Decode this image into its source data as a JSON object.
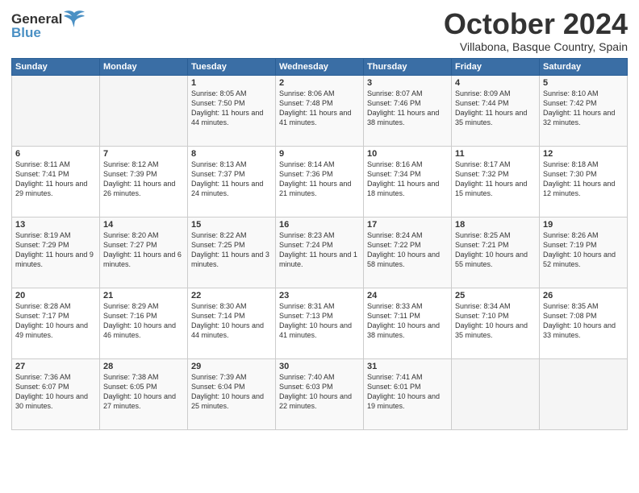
{
  "header": {
    "logo_line1": "General",
    "logo_line2": "Blue",
    "month": "October 2024",
    "location": "Villabona, Basque Country, Spain"
  },
  "weekdays": [
    "Sunday",
    "Monday",
    "Tuesday",
    "Wednesday",
    "Thursday",
    "Friday",
    "Saturday"
  ],
  "weeks": [
    [
      {
        "day": "",
        "content": ""
      },
      {
        "day": "",
        "content": ""
      },
      {
        "day": "1",
        "content": "Sunrise: 8:05 AM\nSunset: 7:50 PM\nDaylight: 11 hours\nand 44 minutes."
      },
      {
        "day": "2",
        "content": "Sunrise: 8:06 AM\nSunset: 7:48 PM\nDaylight: 11 hours\nand 41 minutes."
      },
      {
        "day": "3",
        "content": "Sunrise: 8:07 AM\nSunset: 7:46 PM\nDaylight: 11 hours\nand 38 minutes."
      },
      {
        "day": "4",
        "content": "Sunrise: 8:09 AM\nSunset: 7:44 PM\nDaylight: 11 hours\nand 35 minutes."
      },
      {
        "day": "5",
        "content": "Sunrise: 8:10 AM\nSunset: 7:42 PM\nDaylight: 11 hours\nand 32 minutes."
      }
    ],
    [
      {
        "day": "6",
        "content": "Sunrise: 8:11 AM\nSunset: 7:41 PM\nDaylight: 11 hours\nand 29 minutes."
      },
      {
        "day": "7",
        "content": "Sunrise: 8:12 AM\nSunset: 7:39 PM\nDaylight: 11 hours\nand 26 minutes."
      },
      {
        "day": "8",
        "content": "Sunrise: 8:13 AM\nSunset: 7:37 PM\nDaylight: 11 hours\nand 24 minutes."
      },
      {
        "day": "9",
        "content": "Sunrise: 8:14 AM\nSunset: 7:36 PM\nDaylight: 11 hours\nand 21 minutes."
      },
      {
        "day": "10",
        "content": "Sunrise: 8:16 AM\nSunset: 7:34 PM\nDaylight: 11 hours\nand 18 minutes."
      },
      {
        "day": "11",
        "content": "Sunrise: 8:17 AM\nSunset: 7:32 PM\nDaylight: 11 hours\nand 15 minutes."
      },
      {
        "day": "12",
        "content": "Sunrise: 8:18 AM\nSunset: 7:30 PM\nDaylight: 11 hours\nand 12 minutes."
      }
    ],
    [
      {
        "day": "13",
        "content": "Sunrise: 8:19 AM\nSunset: 7:29 PM\nDaylight: 11 hours\nand 9 minutes."
      },
      {
        "day": "14",
        "content": "Sunrise: 8:20 AM\nSunset: 7:27 PM\nDaylight: 11 hours\nand 6 minutes."
      },
      {
        "day": "15",
        "content": "Sunrise: 8:22 AM\nSunset: 7:25 PM\nDaylight: 11 hours\nand 3 minutes."
      },
      {
        "day": "16",
        "content": "Sunrise: 8:23 AM\nSunset: 7:24 PM\nDaylight: 11 hours\nand 1 minute."
      },
      {
        "day": "17",
        "content": "Sunrise: 8:24 AM\nSunset: 7:22 PM\nDaylight: 10 hours\nand 58 minutes."
      },
      {
        "day": "18",
        "content": "Sunrise: 8:25 AM\nSunset: 7:21 PM\nDaylight: 10 hours\nand 55 minutes."
      },
      {
        "day": "19",
        "content": "Sunrise: 8:26 AM\nSunset: 7:19 PM\nDaylight: 10 hours\nand 52 minutes."
      }
    ],
    [
      {
        "day": "20",
        "content": "Sunrise: 8:28 AM\nSunset: 7:17 PM\nDaylight: 10 hours\nand 49 minutes."
      },
      {
        "day": "21",
        "content": "Sunrise: 8:29 AM\nSunset: 7:16 PM\nDaylight: 10 hours\nand 46 minutes."
      },
      {
        "day": "22",
        "content": "Sunrise: 8:30 AM\nSunset: 7:14 PM\nDaylight: 10 hours\nand 44 minutes."
      },
      {
        "day": "23",
        "content": "Sunrise: 8:31 AM\nSunset: 7:13 PM\nDaylight: 10 hours\nand 41 minutes."
      },
      {
        "day": "24",
        "content": "Sunrise: 8:33 AM\nSunset: 7:11 PM\nDaylight: 10 hours\nand 38 minutes."
      },
      {
        "day": "25",
        "content": "Sunrise: 8:34 AM\nSunset: 7:10 PM\nDaylight: 10 hours\nand 35 minutes."
      },
      {
        "day": "26",
        "content": "Sunrise: 8:35 AM\nSunset: 7:08 PM\nDaylight: 10 hours\nand 33 minutes."
      }
    ],
    [
      {
        "day": "27",
        "content": "Sunrise: 7:36 AM\nSunset: 6:07 PM\nDaylight: 10 hours\nand 30 minutes."
      },
      {
        "day": "28",
        "content": "Sunrise: 7:38 AM\nSunset: 6:05 PM\nDaylight: 10 hours\nand 27 minutes."
      },
      {
        "day": "29",
        "content": "Sunrise: 7:39 AM\nSunset: 6:04 PM\nDaylight: 10 hours\nand 25 minutes."
      },
      {
        "day": "30",
        "content": "Sunrise: 7:40 AM\nSunset: 6:03 PM\nDaylight: 10 hours\nand 22 minutes."
      },
      {
        "day": "31",
        "content": "Sunrise: 7:41 AM\nSunset: 6:01 PM\nDaylight: 10 hours\nand 19 minutes."
      },
      {
        "day": "",
        "content": ""
      },
      {
        "day": "",
        "content": ""
      }
    ]
  ]
}
